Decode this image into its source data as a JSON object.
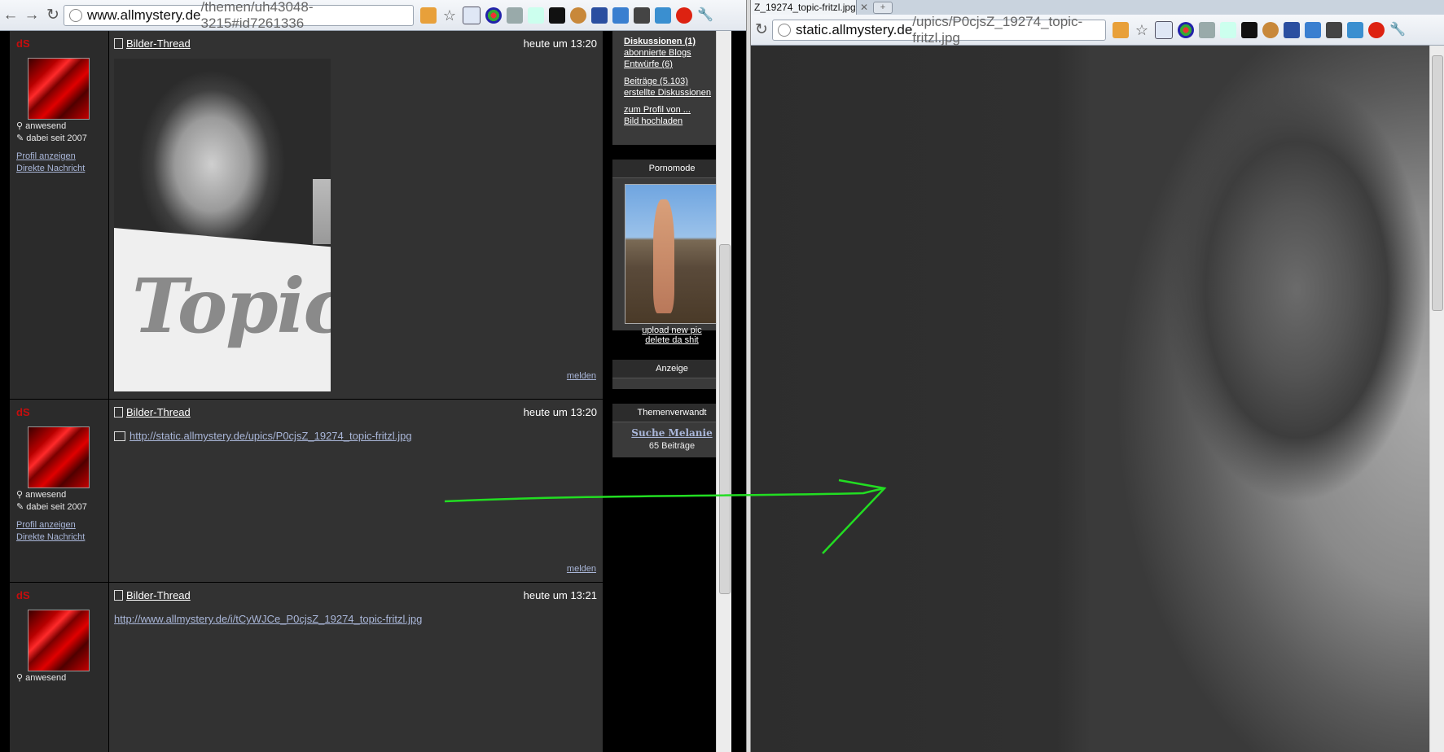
{
  "left_window": {
    "url_domain": "www.allmystery.de",
    "url_path": "/themen/uh43048-3215#id7261336"
  },
  "right_window": {
    "tab_title": "Z_19274_topic-fritzl.jpg",
    "url_domain": "static.allmystery.de",
    "url_path": "/upics/P0cjsZ_19274_topic-fritzl.jpg"
  },
  "posts": [
    {
      "user": "dS",
      "status": "anwesend",
      "since": "dabei seit 2007",
      "profile": "Profil anzeigen",
      "message": "Direkte Nachricht",
      "thread": "Bilder-Thread",
      "time": "heute um 13:20",
      "image_text": "Topic",
      "report": "melden"
    },
    {
      "user": "dS",
      "status": "anwesend",
      "since": "dabei seit 2007",
      "profile": "Profil anzeigen",
      "message": "Direkte Nachricht",
      "thread": "Bilder-Thread",
      "time": "heute um 13:20",
      "link": "http://static.allmystery.de/upics/P0cjsZ_19274_topic-fritzl.jpg",
      "report": "melden"
    },
    {
      "user": "dS",
      "status": "anwesend",
      "thread": "Bilder-Thread",
      "time": "heute um 13:21",
      "link": "http://www.allmystery.de/i/tCyWJCe_P0cjsZ_19274_topic-fritzl.jpg"
    }
  ],
  "sidebar": {
    "discussions": "Diskussionen (1)",
    "blogs": "abonnierte Blogs",
    "drafts": "Entwürfe (6)",
    "posts": "Beiträge (5.103)",
    "created": "erstellte Diskussionen",
    "profile_of": "zum Profil von ...",
    "upload": "Bild hochladen",
    "pornomode_title": "Pornomode",
    "upload_new": "upload new pic",
    "delete": "delete da shit",
    "ad_title": "Anzeige",
    "related_title": "Themenverwandt",
    "related_link": "Suche Melanie",
    "related_count": "65 Beiträge"
  },
  "colors": {
    "username": "#c60d0d",
    "link": "#a9b6d8",
    "annotation_arrow": "#22dd22"
  }
}
